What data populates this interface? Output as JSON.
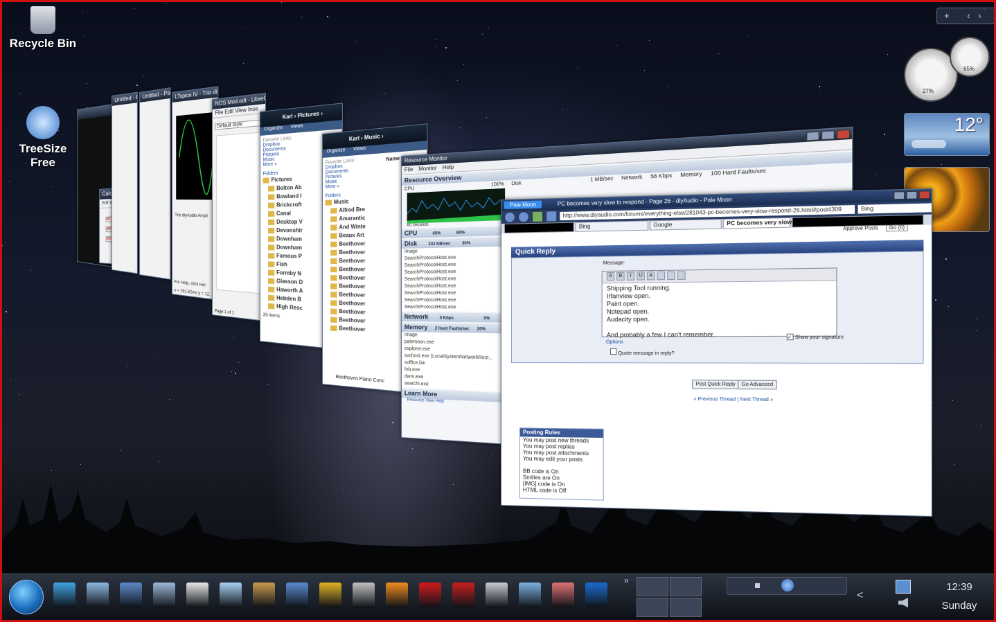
{
  "desktop": {
    "icons": [
      {
        "label": "Recycle Bin"
      },
      {
        "label": "TreeSize Free"
      }
    ]
  },
  "gadgets": {
    "cpu_meter": {
      "cpu": "27%",
      "memory": "65%"
    },
    "weather": {
      "temperature": "12°"
    },
    "toolbar_plus": "+"
  },
  "windows": {
    "writer": {
      "title": "NOS Mod.odt - LibreOffice Writer",
      "menu": [
        "File",
        "Edit",
        "View",
        "Inse"
      ],
      "style": "Default Style",
      "status": "Page 1 of 1"
    },
    "ltspice": {
      "title": "LTspice IV - Trio diy",
      "trace": "Trio diyAudio Ampli",
      "status": "For Help, click Hel",
      "coords": "x = 191.62ms  y = 12."
    },
    "paint": {
      "title": "Untitled - Paint"
    },
    "calculator": {
      "title": "Calculat",
      "menu": [
        "Edit",
        "View"
      ],
      "buttons": [
        "MC",
        "MR",
        "MS"
      ]
    },
    "pictures": {
      "path": "Karl › Pictures ›",
      "organize": "Organize",
      "views": "Views",
      "fav_label": "Favorite Links",
      "links": [
        "Dropbox",
        "Documents",
        "Pictures",
        "Music",
        "More »"
      ],
      "folders_label": "Folders",
      "root": "Pictures",
      "folders": [
        "Bolton Ab",
        "Bowland I",
        "Brickcroft",
        "Canal",
        "Desktop V",
        "Devonshir",
        "Downham",
        "Downham",
        "Famous P",
        "Fish",
        "Formby N",
        "Glasson D",
        "Haworth A",
        "Hebden B",
        "High Resc"
      ],
      "count": "39 items"
    },
    "music": {
      "path": "Karl › Music ›",
      "organize": "Organize",
      "views": "Views",
      "fav_label": "Favorite Links",
      "links": [
        "Dropbox",
        "Documents",
        "Pictures",
        "Music",
        "More »"
      ],
      "folders_label": "Folders",
      "root": "Music",
      "folders": [
        "Alfred Bre",
        "Amarantic",
        "And Winte",
        "Beaux Art",
        "Beethover",
        "Beethover",
        "Beethover",
        "Beethover",
        "Beethover",
        "Beethover",
        "Beethover",
        "Beethover",
        "Beethover",
        "Beethover",
        "Beethover"
      ],
      "col": "Name",
      "selected": "Beethoven Piano Conc"
    },
    "resmon": {
      "title": "Resource Monitor",
      "menu": [
        "File",
        "Monitor",
        "Help"
      ],
      "overview": "Resource Overview",
      "graph_label": "CPU",
      "graph_pct": "100%",
      "graph_time": "60 Seconds",
      "top_labels": [
        "Disk",
        "1 MB/sec",
        "Network",
        "56 Kbps",
        "Memory",
        "100 Hard Faults/sec"
      ],
      "cpu": {
        "name": "CPU",
        "value": "45%",
        "max": "60%"
      },
      "disk": {
        "name": "Disk",
        "value": "332 KB/sec",
        "max": "30%"
      },
      "disk_rows": [
        "Image",
        "SearchProtocolHost.exe",
        "SearchProtocolHost.exe",
        "SearchProtocolHost.exe",
        "SearchProtocolHost.exe",
        "SearchProtocolHost.exe",
        "SearchProtocolHost.exe",
        "SearchProtocolHost.exe",
        "SearchProtocolHost.exe"
      ],
      "network": {
        "name": "Network",
        "value": "0 Kbps",
        "max": "0%"
      },
      "memory": {
        "name": "Memory",
        "value": "2 Hard Faults/sec",
        "max": "20%"
      },
      "memory_rows": [
        "Image",
        "palemoon.exe",
        "explorer.exe",
        "svchost.exe (LocalSystemNetworkRest...",
        "soffice.bin",
        "fnb.exe",
        "dwm.exe",
        "searchi.exe"
      ],
      "learn": "Learn More",
      "learn_link": "Resource View Help"
    },
    "browser": {
      "app_button": "Pale Moon",
      "title": "PC becomes very slow to respond - Page 26 - diyAudio - Pale Moon",
      "url": "http://www.diyaudio.com/forums/everything-else/281043-pc-becomes-very-slow-respond-26.html#post4309",
      "search_tab": "Bing",
      "tabs": [
        "Bing",
        "Google",
        "PC becomes very slow ..."
      ],
      "approve": "Approve Posts",
      "go": "Go (0)",
      "quick_reply": "Quick Reply",
      "message_label": "Message:",
      "message_lines": [
        "Shipping Tool running.",
        "Irfanview open.",
        "Paint open.",
        "Notepad open.",
        "Audacity open.",
        "",
        "And probably a few I can't remember."
      ],
      "options": "Options",
      "quote": "Quote message in reply?",
      "signature": "Show your signature",
      "post_btn": "Post Quick Reply",
      "advanced_btn": "Go Advanced",
      "thread_nav": "« Previous Thread | Next Thread »",
      "rules_title": "Posting Rules",
      "rules": [
        "You may post new threads",
        "You may post replies",
        "You may post attachments",
        "You may edit your posts",
        "",
        "BB code is On",
        "Smilies are On",
        "[IMG] code is On",
        "HTML code is Off"
      ]
    }
  },
  "taskbar": {
    "clock_time": "12:39",
    "clock_day": "Sunday",
    "overflow": "»",
    "show_hidden": "<"
  },
  "colors": {
    "accent": "#d01010",
    "taskbar": "#1a1f28"
  }
}
